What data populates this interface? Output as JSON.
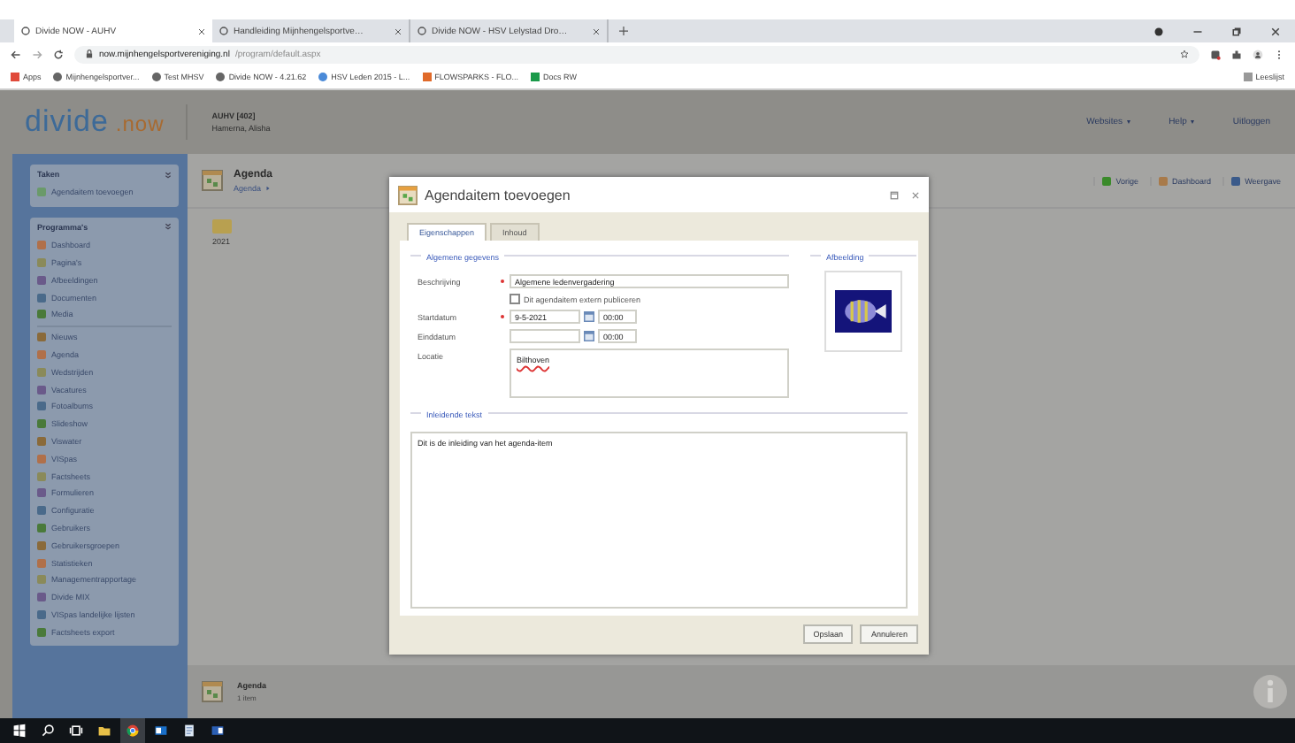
{
  "browser": {
    "tabs": [
      {
        "title": "Divide NOW - AUHV",
        "selected": true
      },
      {
        "title": "Handleiding Mijnhengelsportve…",
        "selected": false
      },
      {
        "title": "Divide NOW - HSV Lelystad Dro…",
        "selected": false
      }
    ],
    "address_host": "now.mijnhengelsportvereniging.nl",
    "address_path": "/program/default.aspx",
    "bookmarks": [
      "Apps",
      "Mijnhengelsportver...",
      "Test MHSV",
      "Divide NOW - 4.21.62",
      "HSV Leden 2015 - L...",
      "FLOWSPARKS - FLO...",
      "Docs RW"
    ],
    "reading_list": "Leeslijst"
  },
  "header": {
    "logo_main": "divide",
    "logo_suffix": ".now",
    "org": "AUHV [402]",
    "user": "Hamerna, Alisha",
    "menu": [
      {
        "label": "Websites",
        "dropdown": true
      },
      {
        "label": "Help",
        "dropdown": true
      },
      {
        "label": "Uitloggen",
        "dropdown": false
      }
    ]
  },
  "sidebar": {
    "tasks": {
      "title": "Taken",
      "items": [
        "Agendaitem toevoegen"
      ]
    },
    "programs": {
      "title": "Programma's",
      "groups": [
        [
          "Dashboard",
          "Pagina's",
          "Afbeeldingen",
          "Documenten",
          "Media"
        ],
        [
          "Nieuws",
          "Agenda",
          "Wedstrijden",
          "Vacatures",
          "Fotoalbums",
          "Slideshow",
          "Viswater",
          "VISpas",
          "Factsheets",
          "Formulieren",
          "Configuratie",
          "Gebruikers",
          "Gebruikersgroepen",
          "Statistieken",
          "Managementrapportage",
          "Divide MIX",
          "VISpas landelijke lijsten",
          "Factsheets export"
        ]
      ]
    }
  },
  "main": {
    "title": "Agenda",
    "breadcrumb": "Agenda",
    "toolbar": [
      "Vorige",
      "Dashboard",
      "Weergave"
    ],
    "folders": [
      "2021"
    ],
    "status": {
      "title": "Agenda",
      "count": "1 item"
    }
  },
  "dialog": {
    "title": "Agendaitem toevoegen",
    "tabs": [
      {
        "label": "Eigenschappen",
        "selected": true
      },
      {
        "label": "Inhoud",
        "selected": false
      }
    ],
    "general_title": "Algemene gegevens",
    "image_title": "Afbeelding",
    "description": {
      "label": "Beschrijving",
      "required": true,
      "value": "Algemene ledenvergadering"
    },
    "publish": {
      "label": "Dit agendaitem extern publiceren",
      "checked": false
    },
    "start": {
      "label": "Startdatum",
      "required": true,
      "date": "9-5-2021",
      "time": "00:00"
    },
    "end": {
      "label": "Einddatum",
      "required": false,
      "time": "00:00"
    },
    "location": {
      "label": "Locatie",
      "value": "Bilthoven"
    },
    "intro_title": "Inleidende tekst",
    "intro": "Dit is de inleiding van het agenda-item",
    "buttons": [
      "Opslaan",
      "Annuleren"
    ]
  }
}
